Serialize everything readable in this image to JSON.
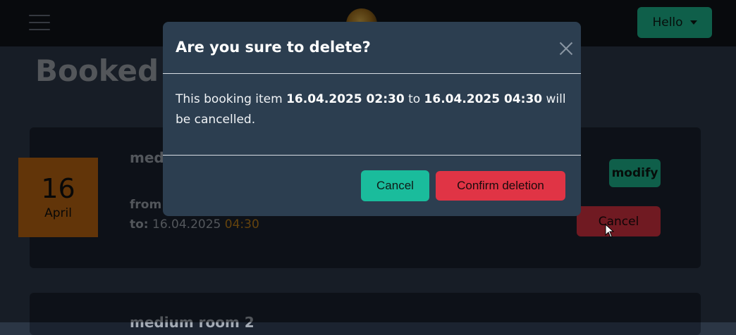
{
  "navbar": {
    "menu_icon": "hamburger-icon",
    "logo_icon": "logo-icon",
    "user_button_label": "Hello",
    "user_button_icon": "caret-down-icon"
  },
  "page": {
    "title": "Booked re"
  },
  "booking_card_1": {
    "room_name": "med",
    "date_day": "16",
    "date_month": "April",
    "from_label": "from",
    "to_label": "to:",
    "to_date": "16.04.2025",
    "to_time": "04:30",
    "modify_label": "modify",
    "cancel_label": "Cancel"
  },
  "booking_card_2": {
    "room_name": "medium room 2"
  },
  "modal": {
    "title": "Are you sure to delete?",
    "close_icon": "close-icon",
    "body_prefix": "This booking item ",
    "body_from": "16.04.2025 02:30",
    "body_mid": " to ",
    "body_to": "16.04.2025 04:30",
    "body_suffix": " will be cancelled.",
    "cancel_label": "Cancel",
    "confirm_label": "Confirm deletion"
  },
  "colors": {
    "primary_green": "#1abc9c",
    "danger_red": "#e03445",
    "modal_bg": "#2c3e50",
    "date_badge": "#c46a12",
    "time_accent": "#c9861b"
  }
}
